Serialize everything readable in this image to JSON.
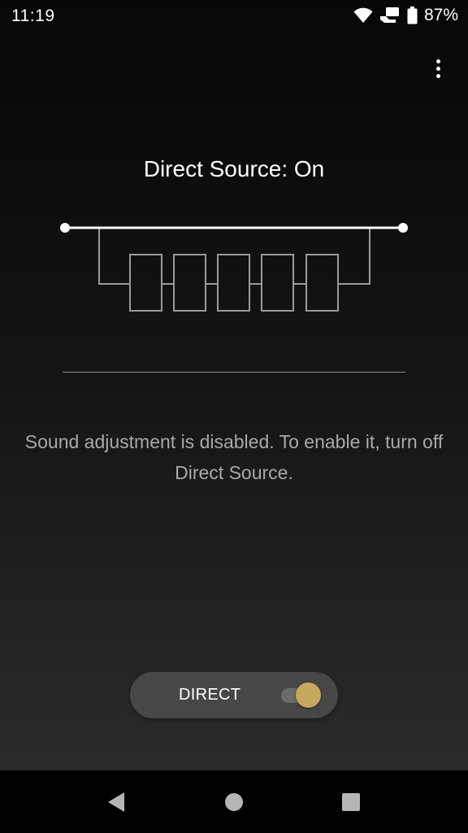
{
  "status_bar": {
    "time": "11:19",
    "battery_percent": "87%",
    "icons": [
      "wifi-icon",
      "cast-icon",
      "battery-icon"
    ]
  },
  "header": {
    "menu_icon": "more-vert-icon"
  },
  "main": {
    "title": "Direct Source: On",
    "diagram_icon": "direct-source-bypass-diagram",
    "message": "Sound adjustment is disabled. To enable it, turn off Direct Source."
  },
  "direct_control": {
    "label": "DIRECT",
    "toggle_on": true,
    "accent_color": "#c7a95e"
  },
  "nav_bar": {
    "icons": [
      "back-icon",
      "home-icon",
      "recents-icon"
    ]
  }
}
